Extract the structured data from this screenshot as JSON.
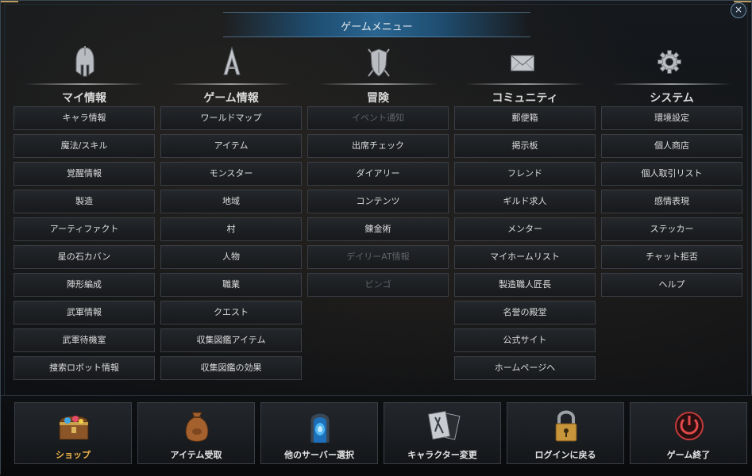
{
  "window": {
    "title": "ゲームメニュー",
    "close_label": "×"
  },
  "columns": [
    {
      "title": "マイ情報",
      "icon": "helmet-icon",
      "items": [
        {
          "label": "キャラ情報",
          "enabled": true
        },
        {
          "label": "魔法/スキル",
          "enabled": true
        },
        {
          "label": "覚醒情報",
          "enabled": true
        },
        {
          "label": "製造",
          "enabled": true
        },
        {
          "label": "アーティファクト",
          "enabled": true
        },
        {
          "label": "星の石カバン",
          "enabled": true
        },
        {
          "label": "陣形編成",
          "enabled": true
        },
        {
          "label": "武軍情報",
          "enabled": true
        },
        {
          "label": "武軍待機室",
          "enabled": true
        },
        {
          "label": "捜索ロボット情報",
          "enabled": true
        }
      ]
    },
    {
      "title": "ゲーム情報",
      "icon": "emblem-icon",
      "items": [
        {
          "label": "ワールドマップ",
          "enabled": true
        },
        {
          "label": "アイテム",
          "enabled": true
        },
        {
          "label": "モンスター",
          "enabled": true
        },
        {
          "label": "地域",
          "enabled": true
        },
        {
          "label": "村",
          "enabled": true
        },
        {
          "label": "人物",
          "enabled": true
        },
        {
          "label": "職業",
          "enabled": true
        },
        {
          "label": "クエスト",
          "enabled": true
        },
        {
          "label": "収集図鑑アイテム",
          "enabled": true
        },
        {
          "label": "収集図鑑の効果",
          "enabled": true
        }
      ]
    },
    {
      "title": "冒険",
      "icon": "shield-swords-icon",
      "items": [
        {
          "label": "イベント通知",
          "enabled": false
        },
        {
          "label": "出席チェック",
          "enabled": true
        },
        {
          "label": "ダイアリー",
          "enabled": true
        },
        {
          "label": "コンテンツ",
          "enabled": true
        },
        {
          "label": "錬金術",
          "enabled": true
        },
        {
          "label": "デイリーAT情報",
          "enabled": false
        },
        {
          "label": "ビンゴ",
          "enabled": false
        }
      ]
    },
    {
      "title": "コミュニティ",
      "icon": "mail-icon",
      "items": [
        {
          "label": "郵便箱",
          "enabled": true
        },
        {
          "label": "掲示板",
          "enabled": true
        },
        {
          "label": "フレンド",
          "enabled": true
        },
        {
          "label": "ギルド求人",
          "enabled": true
        },
        {
          "label": "メンター",
          "enabled": true
        },
        {
          "label": "マイホームリスト",
          "enabled": true
        },
        {
          "label": "製造職人匠長",
          "enabled": true
        },
        {
          "label": "名誉の殿堂",
          "enabled": true
        },
        {
          "label": "公式サイト",
          "enabled": true
        },
        {
          "label": "ホームページへ",
          "enabled": true
        }
      ]
    },
    {
      "title": "システム",
      "icon": "gear-icon",
      "items": [
        {
          "label": "環境設定",
          "enabled": true
        },
        {
          "label": "個人商店",
          "enabled": true
        },
        {
          "label": "個人取引リスト",
          "enabled": true
        },
        {
          "label": "感情表現",
          "enabled": true
        },
        {
          "label": "ステッカー",
          "enabled": true
        },
        {
          "label": "チャット拒否",
          "enabled": true
        },
        {
          "label": "ヘルプ",
          "enabled": true
        }
      ]
    }
  ],
  "bottom": [
    {
      "label": "ショップ",
      "icon": "treasure-chest-icon",
      "highlight": true
    },
    {
      "label": "アイテム受取",
      "icon": "pouch-icon",
      "highlight": false
    },
    {
      "label": "他のサーバー選択",
      "icon": "portal-icon",
      "highlight": false
    },
    {
      "label": "キャラクター変更",
      "icon": "character-cards-icon",
      "highlight": false
    },
    {
      "label": "ログインに戻る",
      "icon": "padlock-icon",
      "highlight": false
    },
    {
      "label": "ゲーム終了",
      "icon": "power-icon",
      "highlight": false
    }
  ],
  "colors": {
    "accent_gold": "#f0b64a",
    "title_bar": "#2a6590",
    "disabled_text": "#5f6266"
  }
}
